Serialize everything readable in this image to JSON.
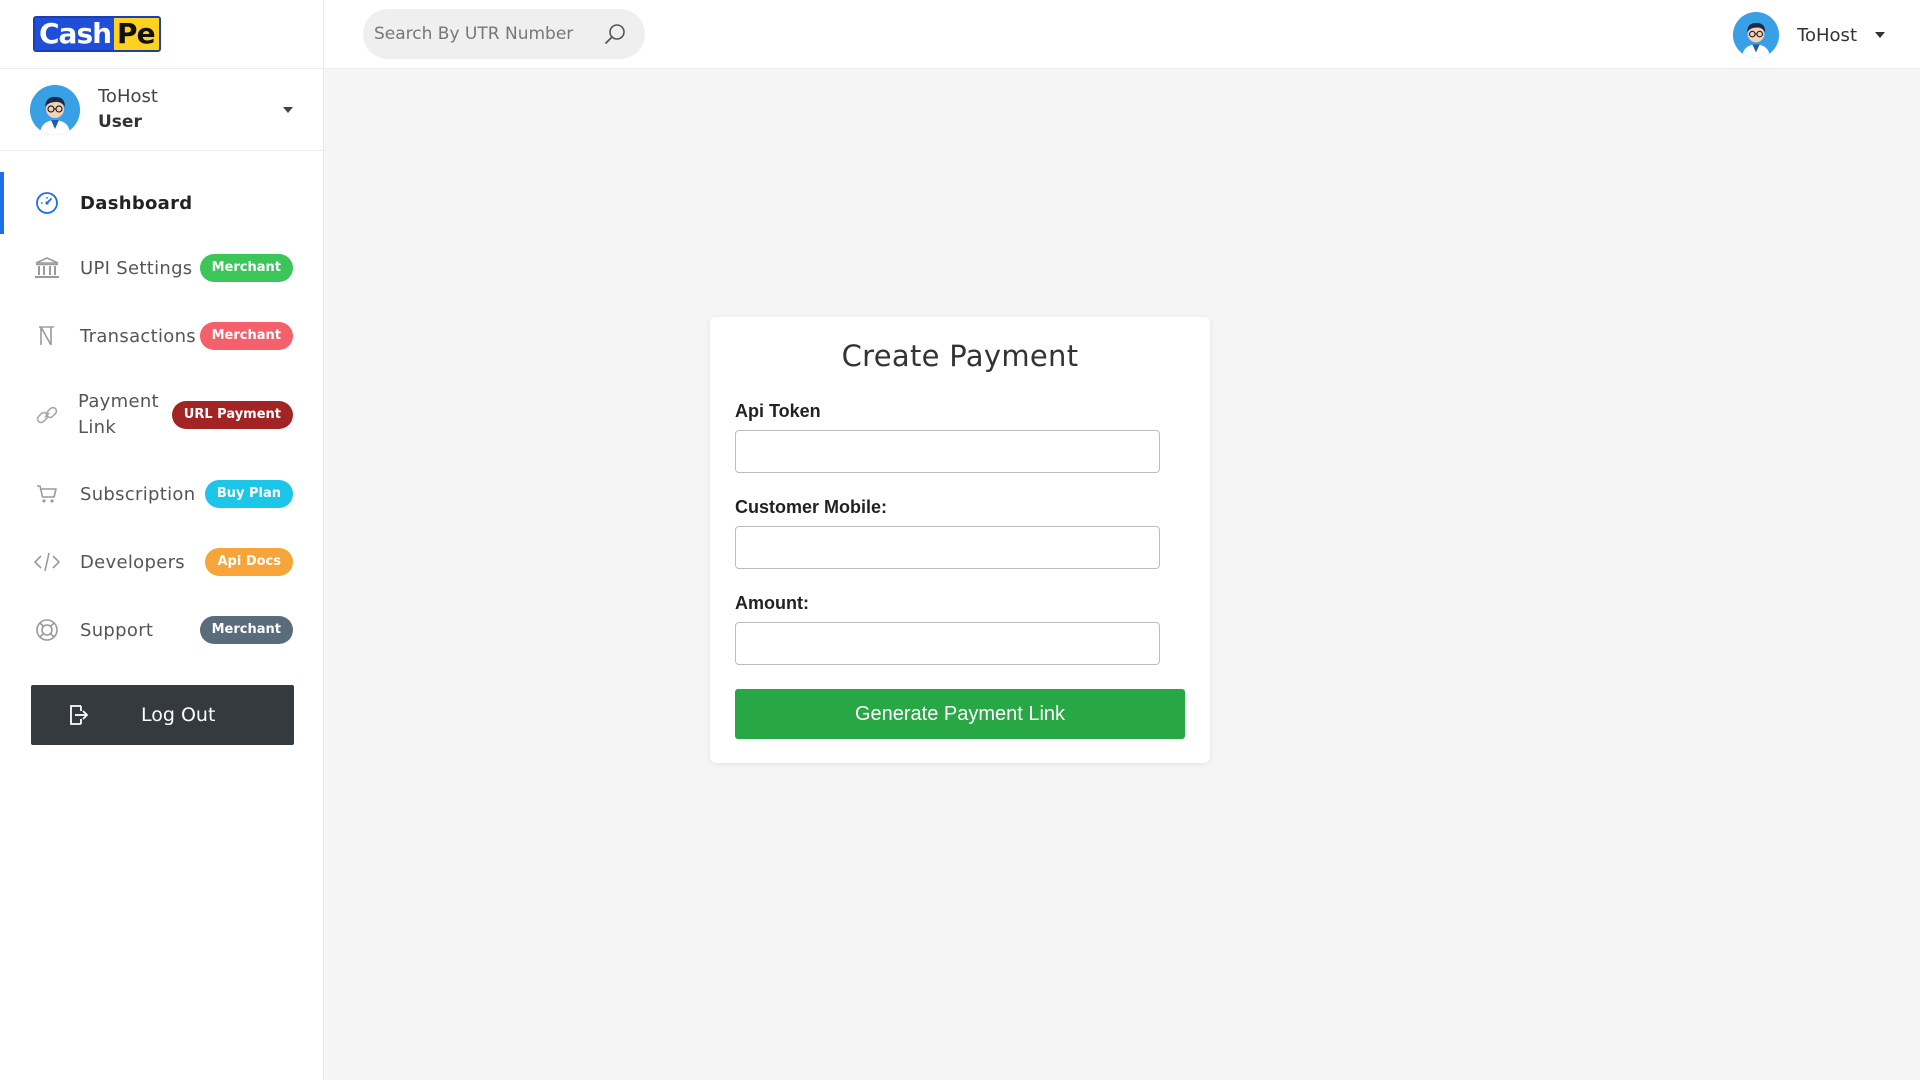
{
  "brand": {
    "logo_part1": "Cash",
    "logo_part2": "Pe"
  },
  "sidebar": {
    "user": {
      "name": "ToHost",
      "role": "User"
    },
    "items": [
      {
        "label": "Dashboard",
        "icon": "dashboard-icon",
        "active": true
      },
      {
        "label": "UPI Settings",
        "icon": "bank-icon",
        "badge": "Merchant",
        "badge_color": "#3cc65a"
      },
      {
        "label": "Transactions",
        "icon": "rupee-icon",
        "badge": "Merchant",
        "badge_color": "#f4606c"
      },
      {
        "label_line1": "Payment",
        "label_line2": "Link",
        "icon": "link-icon",
        "badge": "URL Payment",
        "badge_color": "#a32424"
      },
      {
        "label": "Subscription",
        "icon": "cart-icon",
        "badge": "Buy Plan",
        "badge_color": "#1cc6e9"
      },
      {
        "label": "Developers",
        "icon": "code-icon",
        "badge": "Api Docs",
        "badge_color": "#f7a53b"
      },
      {
        "label": "Support",
        "icon": "lifebuoy-icon",
        "badge": "Merchant",
        "badge_color": "#5a6b7b"
      }
    ],
    "logout_label": "Log Out"
  },
  "header": {
    "search_placeholder": "Search By UTR Number",
    "user_name": "ToHost"
  },
  "form": {
    "title": "Create Payment",
    "api_token_label": "Api Token",
    "api_token_value": "",
    "mobile_label": "Customer Mobile:",
    "mobile_value": "",
    "amount_label": "Amount:",
    "amount_value": "",
    "submit_label": "Generate Payment Link"
  },
  "colors": {
    "accent": "#1d6fe8",
    "primary_button": "#28a745",
    "logout_button": "#343a40"
  }
}
